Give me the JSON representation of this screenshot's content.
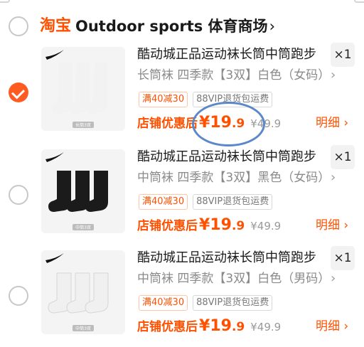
{
  "shop": {
    "logo": "淘宝",
    "name": "Outdoor sports 体育商场",
    "chevron": "›",
    "selected": false
  },
  "items": [
    {
      "title": "酷动城正品运动袜长筒中筒跑步",
      "qty": "×1",
      "sku": "长筒袜 四季款【3双】白色（女码）",
      "tags": [
        "满40减30",
        "88VIP退货包运费"
      ],
      "price_label": "店铺优惠后",
      "price_currency": "¥",
      "price_int": "19",
      "price_dec": ".9",
      "price_old": "¥49.9",
      "detail": "明细 ›",
      "selected": true,
      "thumb_caption": "长筒3双",
      "sock_color": "#f2f2f2"
    },
    {
      "title": "酷动城正品运动袜长筒中筒跑步",
      "qty": "×1",
      "sku": "中筒袜 四季款【3双】黑色（女码）",
      "tags": [
        "满40减30",
        "88VIP退货包运费"
      ],
      "price_label": "店铺优惠后",
      "price_currency": "¥",
      "price_int": "19",
      "price_dec": ".9",
      "price_old": "¥49.9",
      "detail": "明细 ›",
      "selected": false,
      "thumb_caption": "中筒3双",
      "sock_color": "#1b1b1b"
    },
    {
      "title": "酷动城正品运动袜长筒中筒跑步",
      "qty": "×1",
      "sku": "中筒袜 四季款【3双】白色（男码）",
      "tags": [
        "满40减30",
        "88VIP退货包运费"
      ],
      "price_label": "店铺优惠后",
      "price_currency": "¥",
      "price_int": "19",
      "price_dec": ".9",
      "price_old": "¥49.9",
      "detail": "明细 ›",
      "selected": false,
      "thumb_caption": "中筒3双",
      "sock_color": "#f0f0f0"
    }
  ],
  "colors": {
    "accent": "#ff5000",
    "annotation": "#5b88c8"
  }
}
